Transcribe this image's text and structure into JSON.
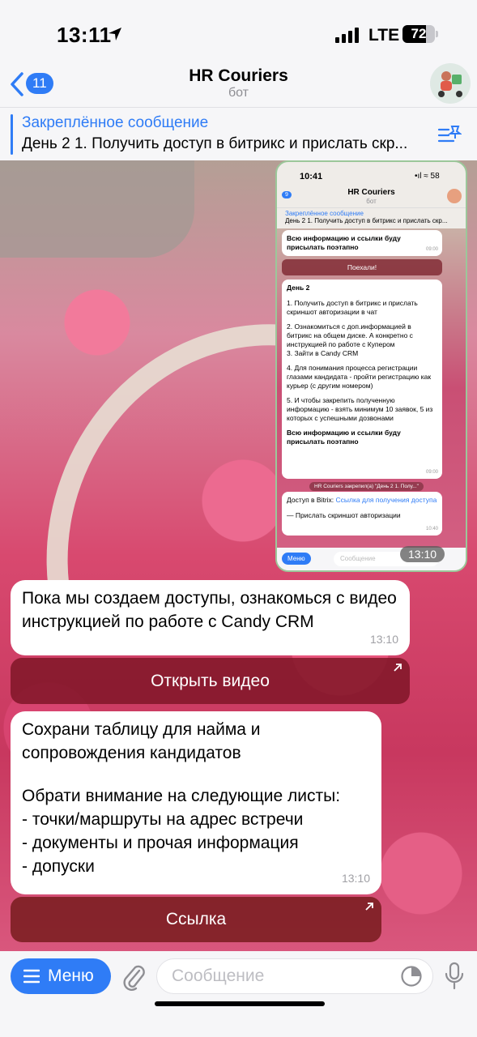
{
  "status_bar": {
    "time": "13:11",
    "carrier": "LTE",
    "battery": "72",
    "battery_level": 0.72
  },
  "header": {
    "back_count": "11",
    "title": "HR Couriers",
    "subtitle": "бот"
  },
  "pinned": {
    "label": "Закреплённое сообщение",
    "text": "День 2 1. Получить доступ в битрикс и прислать скр..."
  },
  "embedded_screenshot": {
    "time": "10:41",
    "status_icons": "•ıl ≈ 58",
    "back_count": "9",
    "title": "HR Couriers",
    "subtitle": "бот",
    "pinned_label": "Закреплённое сообщение",
    "pinned_text": "День 2 1. Получить доступ в битрикс и прислать скр...",
    "msg_top": "Всю информацию и ссылки буду присылать поэтапно",
    "msg_top_time": "09:00",
    "start_button": "Поехали!",
    "day_title": "День 2",
    "day_items": [
      "1. Получить доступ в битрикс и прислать скриншот авторизации в чат",
      "2. Ознакомиться с доп.информацией в битрикс на общем диске. А конкретно с инструкцией по работе с Купером",
      "3. Зайти в Candy CRM",
      "4. Для понимания процесса регистрации глазами кандидата - пройти регистрацию как курьер (с другим номером)",
      "5. И чтобы закрепить полученную информацию - взять минимум 10 заявок, 5 из которых с успешными дозвонами"
    ],
    "day_footer": "Всю информацию и ссылки буду присылать поэтапно",
    "day_time": "09:00",
    "system_note": "HR Couriers закрепил(а) \"День 2 1. Полу...\"",
    "access_prefix": "Доступ в Bitrix:",
    "access_link": "Ссылка для получения доступа",
    "access_note": "— Прислать скриншот авторизации",
    "access_time": "10:40",
    "menu": "Меню",
    "input_placeholder": "Сообщение",
    "overlay_time": "13:10"
  },
  "messages": [
    {
      "text": "Пока мы создаем доступы, ознакомься с видео инструкцией по работе с Candy CRM",
      "time": "13:10",
      "button": "Открыть видео"
    },
    {
      "line1": "Сохрани таблицу для найма и",
      "line2": "сопровождения кандидатов",
      "line3": "Обрати внимание на следующие листы:",
      "line4": "- точки/маршруты на адрес встречи",
      "line5": "- документы и прочая информация",
      "line6": "- допуски",
      "time": "13:10",
      "button": "Ссылка"
    }
  ],
  "input_bar": {
    "menu_label": "Меню",
    "placeholder": "Сообщение"
  },
  "colors": {
    "accent": "#2f7cf6",
    "button_bg": "#801628"
  }
}
